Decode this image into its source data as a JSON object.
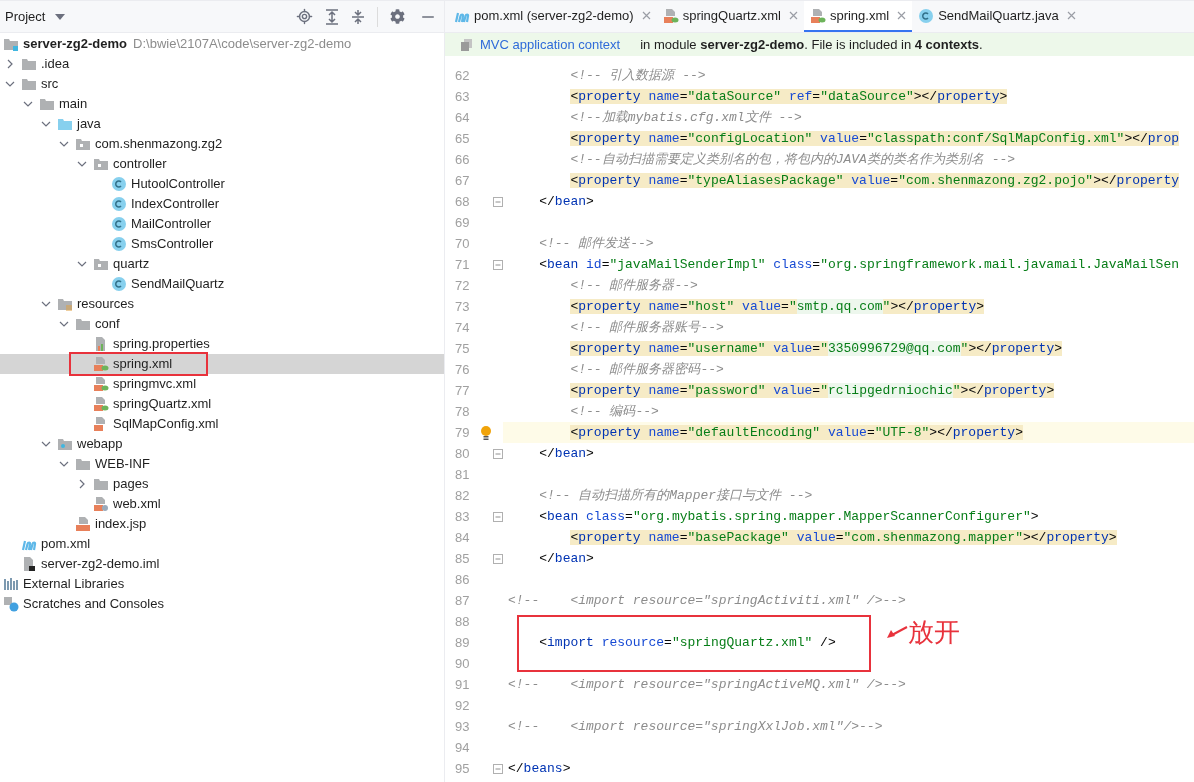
{
  "sidebar": {
    "title": "Project",
    "tree": [
      {
        "label": "server-zg2-demo",
        "path": "D:\\bwie\\2107A\\code\\server-zg2-demo",
        "kind": "module",
        "selected": false,
        "children": [
          {
            "label": ".idea",
            "kind": "folder",
            "expanded": false,
            "selected": false
          },
          {
            "label": "src",
            "kind": "folder",
            "expanded": true,
            "selected": false,
            "children": [
              {
                "label": "main",
                "kind": "folder",
                "expanded": true,
                "selected": false,
                "children": [
                  {
                    "label": "java",
                    "kind": "source",
                    "expanded": true,
                    "selected": false,
                    "children": [
                      {
                        "label": "com.shenmazong.zg2",
                        "kind": "package",
                        "expanded": true,
                        "selected": false,
                        "children": [
                          {
                            "label": "controller",
                            "kind": "package",
                            "expanded": true,
                            "selected": false,
                            "children": [
                              {
                                "label": "HutoolController",
                                "kind": "class",
                                "selected": false
                              },
                              {
                                "label": "IndexController",
                                "kind": "class",
                                "selected": false
                              },
                              {
                                "label": "MailController",
                                "kind": "class",
                                "selected": false
                              },
                              {
                                "label": "SmsController",
                                "kind": "class",
                                "selected": false
                              }
                            ]
                          },
                          {
                            "label": "quartz",
                            "kind": "package",
                            "expanded": true,
                            "selected": false,
                            "children": [
                              {
                                "label": "SendMailQuartz",
                                "kind": "class",
                                "selected": false
                              }
                            ]
                          }
                        ]
                      }
                    ]
                  },
                  {
                    "label": "resources",
                    "kind": "resources",
                    "expanded": true,
                    "selected": false,
                    "children": [
                      {
                        "label": "conf",
                        "kind": "folder",
                        "expanded": true,
                        "selected": false,
                        "children": [
                          {
                            "label": "spring.properties",
                            "kind": "properties",
                            "selected": false
                          },
                          {
                            "label": "spring.xml",
                            "kind": "spring",
                            "selected": true,
                            "annotated": true
                          },
                          {
                            "label": "springmvc.xml",
                            "kind": "spring",
                            "selected": false
                          },
                          {
                            "label": "springQuartz.xml",
                            "kind": "spring",
                            "selected": false
                          },
                          {
                            "label": "SqlMapConfig.xml",
                            "kind": "xml",
                            "selected": false
                          }
                        ]
                      }
                    ]
                  },
                  {
                    "label": "webapp",
                    "kind": "web",
                    "expanded": true,
                    "selected": false,
                    "children": [
                      {
                        "label": "WEB-INF",
                        "kind": "folder",
                        "expanded": true,
                        "selected": false,
                        "children": [
                          {
                            "label": "pages",
                            "kind": "folder",
                            "expanded": false,
                            "selected": false
                          },
                          {
                            "label": "web.xml",
                            "kind": "webxml",
                            "selected": false
                          }
                        ]
                      },
                      {
                        "label": "index.jsp",
                        "kind": "jsp",
                        "selected": false
                      }
                    ]
                  }
                ]
              }
            ]
          },
          {
            "label": "pom.xml",
            "kind": "maven",
            "selected": false
          },
          {
            "label": "server-zg2-demo.iml",
            "kind": "iml",
            "selected": false
          }
        ]
      },
      {
        "label": "External Libraries",
        "kind": "libraries",
        "selected": false
      },
      {
        "label": "Scratches and Consoles",
        "kind": "scratches",
        "selected": false
      }
    ]
  },
  "tabs": [
    {
      "label": "pom.xml (server-zg2-demo)",
      "kind": "maven",
      "selected": false
    },
    {
      "label": "springQuartz.xml",
      "kind": "spring",
      "selected": false
    },
    {
      "label": "spring.xml",
      "kind": "spring",
      "selected": true
    },
    {
      "label": "SendMailQuartz.java",
      "kind": "class",
      "selected": false
    }
  ],
  "info_bar": {
    "link": "MVC application context",
    "text": "in module **server-zg2-demo**. File is included in **4 contexts**."
  },
  "annotation": {
    "text": "放开"
  },
  "lines": [
    {
      "number": "62",
      "tokens": [
        {
          "kind": "comment",
          "text": "        <!-- 引入数据源 -->"
        }
      ]
    },
    {
      "number": "63",
      "highlight": true,
      "tokens": [
        {
          "kind": "punct",
          "text": "        <"
        },
        {
          "kind": "tag",
          "text": "property"
        },
        {
          "kind": "attr",
          "text": " name"
        },
        {
          "kind": "punct",
          "text": "="
        },
        {
          "kind": "string",
          "text": "\"dataSource\""
        },
        {
          "kind": "attr",
          "text": " ref"
        },
        {
          "kind": "punct",
          "text": "="
        },
        {
          "kind": "string",
          "text": "\"dataSource\""
        },
        {
          "kind": "punct",
          "text": "></"
        },
        {
          "kind": "tag",
          "text": "property"
        },
        {
          "kind": "punct",
          "text": ">"
        }
      ]
    },
    {
      "number": "64",
      "tokens": [
        {
          "kind": "comment",
          "text": "        <!--加载mybatis.cfg.xml文件 -->"
        }
      ]
    },
    {
      "number": "65",
      "highlight": true,
      "tokens": [
        {
          "kind": "punct",
          "text": "        <"
        },
        {
          "kind": "tag",
          "text": "property"
        },
        {
          "kind": "attr",
          "text": " name"
        },
        {
          "kind": "punct",
          "text": "="
        },
        {
          "kind": "string",
          "text": "\"configLocation\""
        },
        {
          "kind": "attr",
          "text": " value"
        },
        {
          "kind": "punct",
          "text": "="
        },
        {
          "kind": "string",
          "text": "\"classpath:conf/SqlMapConfig.xml\""
        },
        {
          "kind": "punct",
          "text": "></"
        },
        {
          "kind": "tag",
          "text": "prop"
        }
      ]
    },
    {
      "number": "66",
      "tokens": [
        {
          "kind": "comment",
          "text": "        <!--自动扫描需要定义类别名的包，将包内的JAVA类的类名作为类别名 -->"
        }
      ]
    },
    {
      "number": "67",
      "highlight": true,
      "tokens": [
        {
          "kind": "punct",
          "text": "        <"
        },
        {
          "kind": "tag",
          "text": "property"
        },
        {
          "kind": "attr",
          "text": " name"
        },
        {
          "kind": "punct",
          "text": "="
        },
        {
          "kind": "string",
          "text": "\"typeAliasesPackage\""
        },
        {
          "kind": "attr",
          "text": " value"
        },
        {
          "kind": "punct",
          "text": "="
        },
        {
          "kind": "string",
          "text": "\"com.shenmazong.zg2.pojo\""
        },
        {
          "kind": "punct",
          "text": "></"
        },
        {
          "kind": "tag",
          "text": "property"
        }
      ]
    },
    {
      "number": "68",
      "fold": true,
      "tokens": [
        {
          "kind": "punct",
          "text": "    </"
        },
        {
          "kind": "tag",
          "text": "bean"
        },
        {
          "kind": "punct",
          "text": ">"
        }
      ]
    },
    {
      "number": "69"
    },
    {
      "number": "70",
      "tokens": [
        {
          "kind": "comment",
          "text": "    <!-- 邮件发送-->"
        }
      ]
    },
    {
      "number": "71",
      "fold": true,
      "tokens": [
        {
          "kind": "punct",
          "text": "    <"
        },
        {
          "kind": "tag",
          "text": "bean"
        },
        {
          "kind": "attr",
          "text": " id"
        },
        {
          "kind": "punct",
          "text": "="
        },
        {
          "kind": "string",
          "text": "\"javaMailSenderImpl\""
        },
        {
          "kind": "attr",
          "text": " class"
        },
        {
          "kind": "punct",
          "text": "="
        },
        {
          "kind": "string",
          "text": "\"org.springframework.mail.javamail.JavaMailSen"
        }
      ]
    },
    {
      "number": "72",
      "tokens": [
        {
          "kind": "comment",
          "text": "        <!-- 邮件服务器-->"
        }
      ]
    },
    {
      "number": "73",
      "highlight": true,
      "tokens": [
        {
          "kind": "punct",
          "text": "        <"
        },
        {
          "kind": "tag",
          "text": "property"
        },
        {
          "kind": "attr",
          "text": " name"
        },
        {
          "kind": "punct",
          "text": "="
        },
        {
          "kind": "string",
          "text": "\"host\""
        },
        {
          "kind": "attr",
          "text": " value"
        },
        {
          "kind": "punct",
          "text": "="
        },
        {
          "kind": "string",
          "text": "\""
        },
        {
          "kind": "injected",
          "text": "smtp.qq.com"
        },
        {
          "kind": "string",
          "text": "\""
        },
        {
          "kind": "punct",
          "text": "></"
        },
        {
          "kind": "tag",
          "text": "property"
        },
        {
          "kind": "punct",
          "text": ">"
        }
      ]
    },
    {
      "number": "74",
      "tokens": [
        {
          "kind": "comment",
          "text": "        <!-- 邮件服务器账号-->"
        }
      ]
    },
    {
      "number": "75",
      "highlight": true,
      "tokens": [
        {
          "kind": "punct",
          "text": "        <"
        },
        {
          "kind": "tag",
          "text": "property"
        },
        {
          "kind": "attr",
          "text": " name"
        },
        {
          "kind": "punct",
          "text": "="
        },
        {
          "kind": "string",
          "text": "\"username\""
        },
        {
          "kind": "attr",
          "text": " value"
        },
        {
          "kind": "punct",
          "text": "="
        },
        {
          "kind": "string",
          "text": "\""
        },
        {
          "kind": "injected",
          "text": "3350996729@qq.com"
        },
        {
          "kind": "string",
          "text": "\""
        },
        {
          "kind": "punct",
          "text": "></"
        },
        {
          "kind": "tag",
          "text": "property"
        },
        {
          "kind": "punct",
          "text": ">"
        }
      ]
    },
    {
      "number": "76",
      "tokens": [
        {
          "kind": "comment",
          "text": "        <!-- 邮件服务器密码-->"
        }
      ]
    },
    {
      "number": "77",
      "highlight": true,
      "tokens": [
        {
          "kind": "punct",
          "text": "        <"
        },
        {
          "kind": "tag",
          "text": "property"
        },
        {
          "kind": "attr",
          "text": " name"
        },
        {
          "kind": "punct",
          "text": "="
        },
        {
          "kind": "string",
          "text": "\"password\""
        },
        {
          "kind": "attr",
          "text": " value"
        },
        {
          "kind": "punct",
          "text": "="
        },
        {
          "kind": "string",
          "text": "\""
        },
        {
          "kind": "injected",
          "text": "rclipgedrniochic"
        },
        {
          "kind": "string",
          "text": "\""
        },
        {
          "kind": "punct",
          "text": "></"
        },
        {
          "kind": "tag",
          "text": "property"
        },
        {
          "kind": "punct",
          "text": ">"
        }
      ]
    },
    {
      "number": "78",
      "tokens": [
        {
          "kind": "comment",
          "text": "        <!-- 编码-->"
        }
      ]
    },
    {
      "number": "79",
      "highlight": true,
      "current": true,
      "tokens": [
        {
          "kind": "punct",
          "text": "        <"
        },
        {
          "kind": "tag",
          "text": "property"
        },
        {
          "kind": "attr",
          "text": " name"
        },
        {
          "kind": "punct",
          "text": "="
        },
        {
          "kind": "string",
          "text": "\"defaultEncoding\""
        },
        {
          "kind": "attr",
          "text": " value"
        },
        {
          "kind": "punct",
          "text": "="
        },
        {
          "kind": "string",
          "text": "\"UTF-8\""
        },
        {
          "kind": "punct",
          "text": "></"
        },
        {
          "kind": "tag",
          "text": "property"
        },
        {
          "kind": "punct",
          "text": ">"
        }
      ]
    },
    {
      "number": "80",
      "fold": true,
      "tokens": [
        {
          "kind": "punct",
          "text": "    </"
        },
        {
          "kind": "tag",
          "text": "bean"
        },
        {
          "kind": "punct",
          "text": ">"
        }
      ]
    },
    {
      "number": "81"
    },
    {
      "number": "82",
      "tokens": [
        {
          "kind": "comment",
          "text": "    <!-- 自动扫描所有的Mapper接口与文件 -->"
        }
      ]
    },
    {
      "number": "83",
      "fold": true,
      "tokens": [
        {
          "kind": "punct",
          "text": "    <"
        },
        {
          "kind": "tag",
          "text": "bean"
        },
        {
          "kind": "attr",
          "text": " class"
        },
        {
          "kind": "punct",
          "text": "="
        },
        {
          "kind": "string",
          "text": "\"org.mybatis.spring.mapper.MapperScannerConfigurer\""
        },
        {
          "kind": "punct",
          "text": ">"
        }
      ]
    },
    {
      "number": "84",
      "highlight": true,
      "tokens": [
        {
          "kind": "punct",
          "text": "        <"
        },
        {
          "kind": "tag",
          "text": "property"
        },
        {
          "kind": "attr",
          "text": " name"
        },
        {
          "kind": "punct",
          "text": "="
        },
        {
          "kind": "string",
          "text": "\"basePackage\""
        },
        {
          "kind": "attr",
          "text": " value"
        },
        {
          "kind": "punct",
          "text": "="
        },
        {
          "kind": "string",
          "text": "\"com.shenmazong.mapper\""
        },
        {
          "kind": "punct",
          "text": "></"
        },
        {
          "kind": "tag",
          "text": "property"
        },
        {
          "kind": "punct",
          "text": ">"
        }
      ]
    },
    {
      "number": "85",
      "fold": true,
      "tokens": [
        {
          "kind": "punct",
          "text": "    </"
        },
        {
          "kind": "tag",
          "text": "bean"
        },
        {
          "kind": "punct",
          "text": ">"
        }
      ]
    },
    {
      "number": "86"
    },
    {
      "number": "87",
      "tokens": [
        {
          "kind": "comment",
          "text": "<!--    <import resource=\"springActiviti.xml\" />-->"
        }
      ]
    },
    {
      "number": "88",
      "boxed": true
    },
    {
      "number": "89",
      "boxed": true,
      "tokens": [
        {
          "kind": "punct",
          "text": "    <"
        },
        {
          "kind": "tag",
          "text": "import"
        },
        {
          "kind": "attr",
          "text": " resource"
        },
        {
          "kind": "punct",
          "text": "="
        },
        {
          "kind": "string",
          "text": "\"springQuartz.xml\""
        },
        {
          "kind": "punct",
          "text": " />"
        }
      ]
    },
    {
      "number": "90",
      "boxed": true
    },
    {
      "number": "91",
      "tokens": [
        {
          "kind": "comment",
          "text": "<!--    <import resource=\"springActiveMQ.xml\" />-->"
        }
      ]
    },
    {
      "number": "92"
    },
    {
      "number": "93",
      "tokens": [
        {
          "kind": "comment",
          "text": "<!--    <import resource=\"springXxlJob.xml\"/>-->"
        }
      ]
    },
    {
      "number": "94"
    },
    {
      "number": "95",
      "fold": true,
      "tokens": [
        {
          "kind": "punct",
          "text": "</"
        },
        {
          "kind": "tag",
          "text": "beans"
        },
        {
          "kind": "punct",
          "text": ">"
        }
      ]
    }
  ]
}
